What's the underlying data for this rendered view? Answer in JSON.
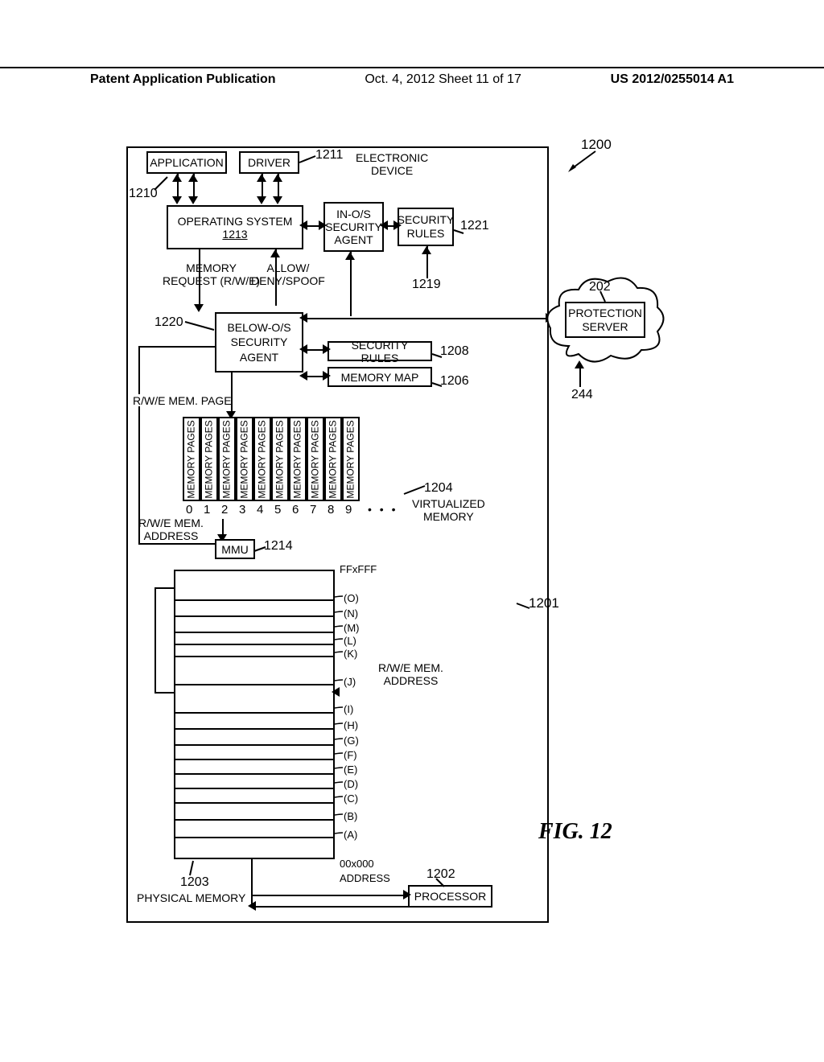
{
  "header": {
    "left": "Patent Application Publication",
    "center": "Oct. 4, 2012  Sheet 11 of 17",
    "right": "US 2012/0255014 A1"
  },
  "figure_label": "FIG. 12",
  "device_header": "ELECTRONIC\nDEVICE",
  "boxes": {
    "application": "APPLICATION",
    "driver": "DRIVER",
    "os": "OPERATING SYSTEM",
    "os_num": "1213",
    "in_os_agent": "IN-O/S\nSECURITY\nAGENT",
    "sec_rules_top": "SECURITY\nRULES",
    "below_agent": "BELOW-O/S\nSECURITY\nAGENT",
    "sec_rules_mid": "SECURITY RULES",
    "mem_map": "MEMORY MAP",
    "mmu": "MMU",
    "processor": "PROCESSOR",
    "prot_server": "PROTECTION\nSERVER"
  },
  "labels": {
    "mem_req": "MEMORY\nREQUEST (R/W/E)",
    "allow_deny": "ALLOW/\nDENY/SPOOF",
    "rwe_page": "R/W/E MEM. PAGE",
    "rwe_addr_left": "R/W/E MEM.\nADDRESS",
    "rwe_addr_right": "R/W/E MEM.\nADDRESS",
    "virt_mem": "VIRTUALIZED\nMEMORY",
    "phys_mem": "PHYSICAL MEMORY",
    "addr_title": "ADDRESS",
    "addr_top": "FFxFFF",
    "addr_bot": "00x000"
  },
  "refs": {
    "r1200": "1200",
    "r1210": "1210",
    "r1211": "1211",
    "r1213": "1213",
    "r1219": "1219",
    "r1220": "1220",
    "r1221": "1221",
    "r1208": "1208",
    "r1206": "1206",
    "r1204": "1204",
    "r1214": "1214",
    "r1201": "1201",
    "r1202": "1202",
    "r1203": "1203",
    "r202": "202",
    "r244": "244"
  },
  "mem_pages": {
    "text": "MEMORY PAGES",
    "indices": [
      "0",
      "1",
      "2",
      "3",
      "4",
      "5",
      "6",
      "7",
      "8",
      "9"
    ],
    "dots": "• • •"
  },
  "phys_rows": [
    "(O)",
    "(N)",
    "(M)",
    "(L)",
    "(K)",
    "(J)",
    "(I)",
    "(H)",
    "(G)",
    "(F)",
    "(E)",
    "(D)",
    "(C)",
    "(B)",
    "(A)"
  ]
}
